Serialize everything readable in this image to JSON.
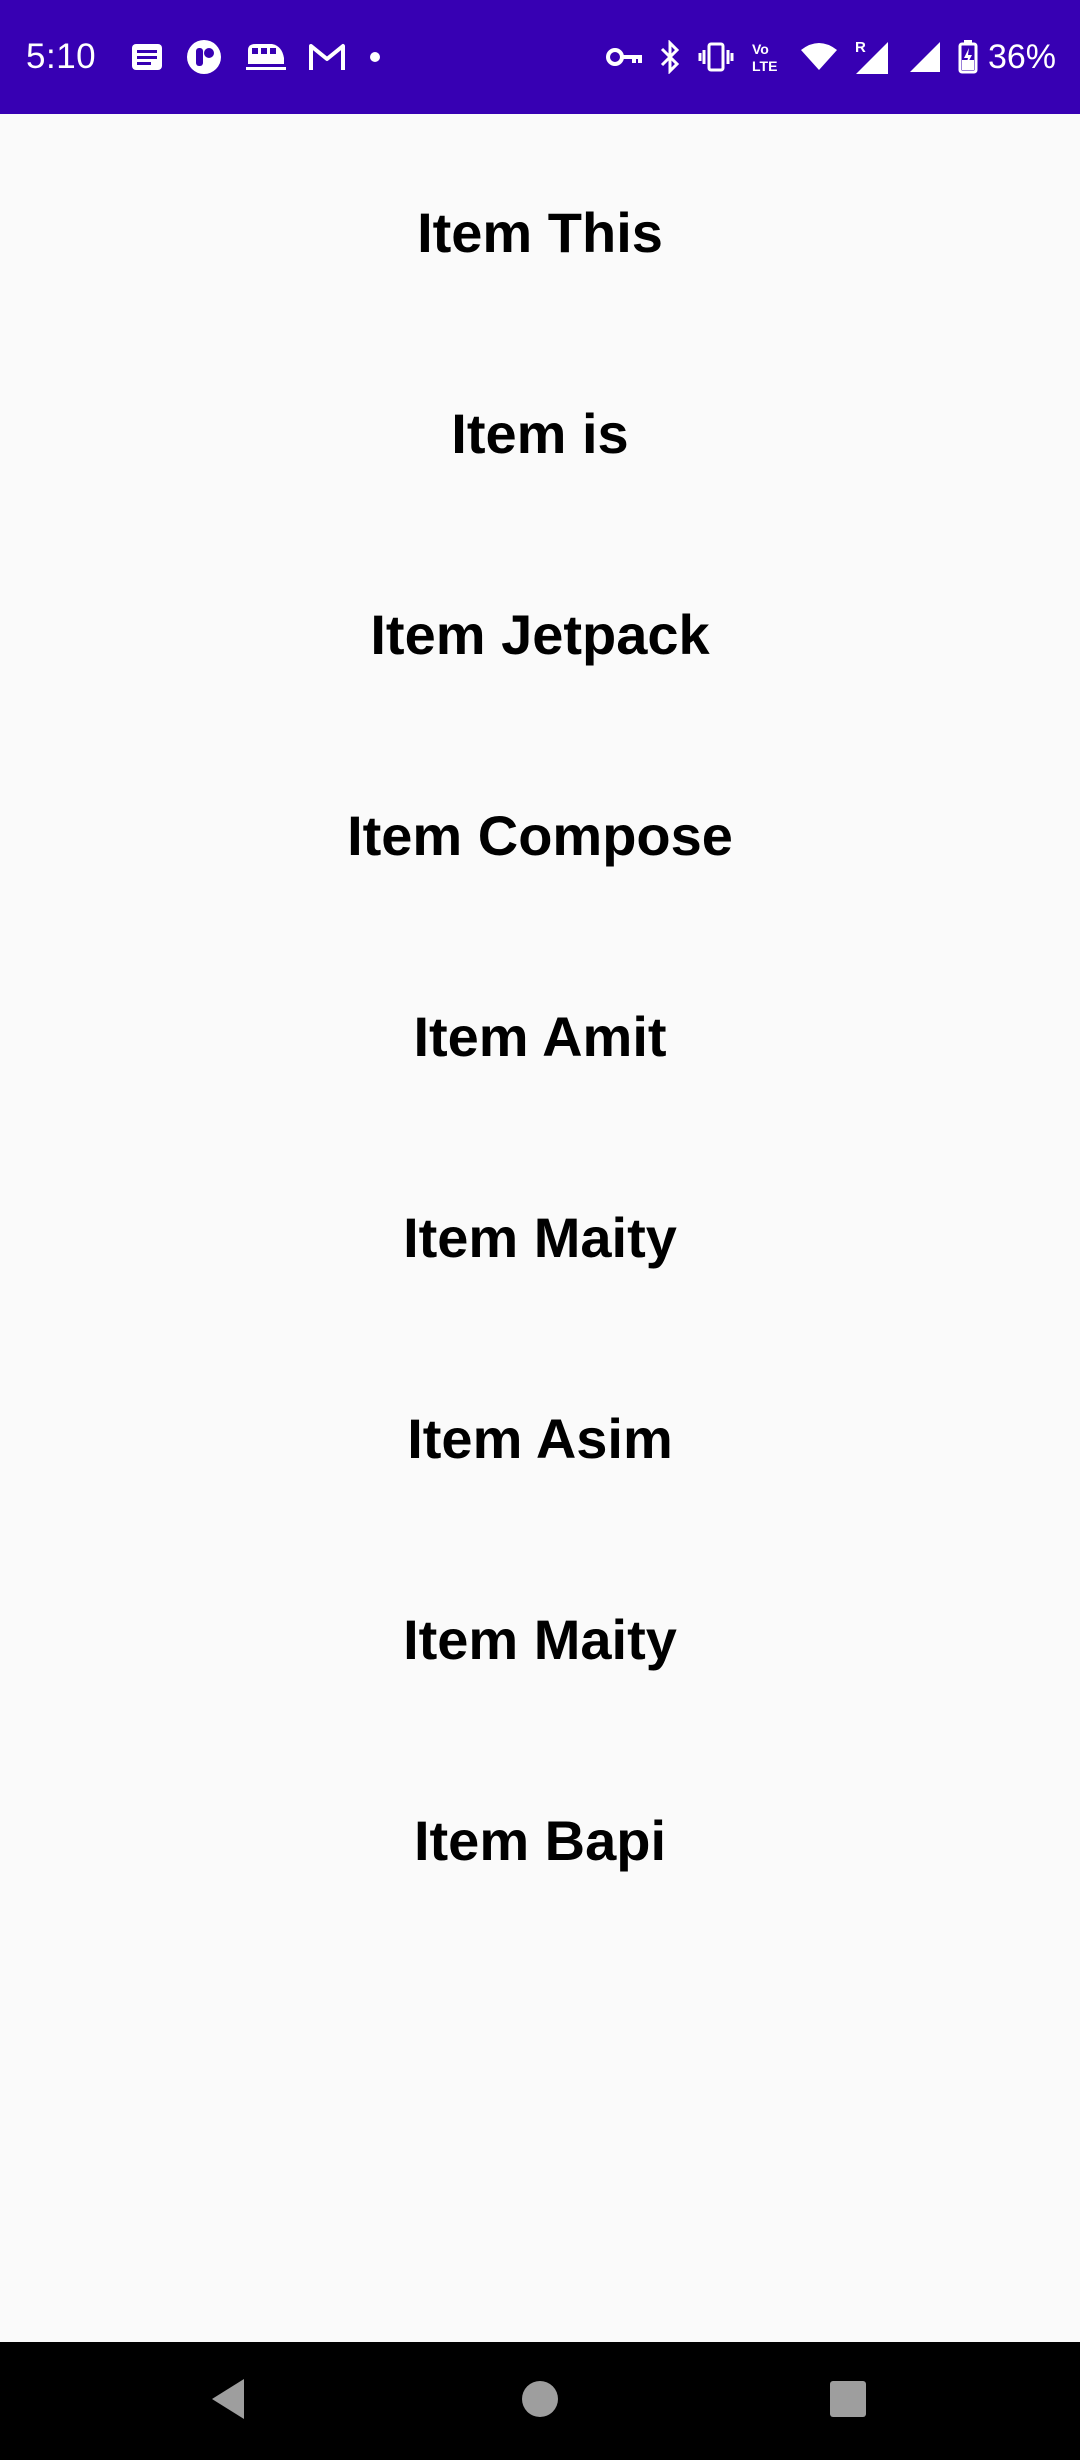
{
  "status_bar": {
    "time": "5:10",
    "battery_percent": "36%",
    "background_color": "#3700b3",
    "left_icons": [
      "news-icon",
      "app-circle-icon",
      "train-icon",
      "gmail-icon",
      "dot-icon"
    ],
    "right_icons": [
      "key-icon",
      "bluetooth-icon",
      "vibrate-icon",
      "volte-icon",
      "wifi-icon",
      "signal-r-icon",
      "signal-icon",
      "battery-charging-icon"
    ],
    "volte_text_top": "Vo",
    "volte_text_bottom": "LTE",
    "roaming_text": "R"
  },
  "list": {
    "items": [
      {
        "label": "Item This"
      },
      {
        "label": "Item is"
      },
      {
        "label": "Item Jetpack"
      },
      {
        "label": "Item Compose"
      },
      {
        "label": "Item Amit"
      },
      {
        "label": "Item Maity"
      },
      {
        "label": "Item Asim"
      },
      {
        "label": "Item Maity"
      },
      {
        "label": "Item Bapi"
      }
    ]
  },
  "nav_bar": {
    "buttons": [
      "back-icon",
      "home-icon",
      "recents-icon"
    ]
  }
}
